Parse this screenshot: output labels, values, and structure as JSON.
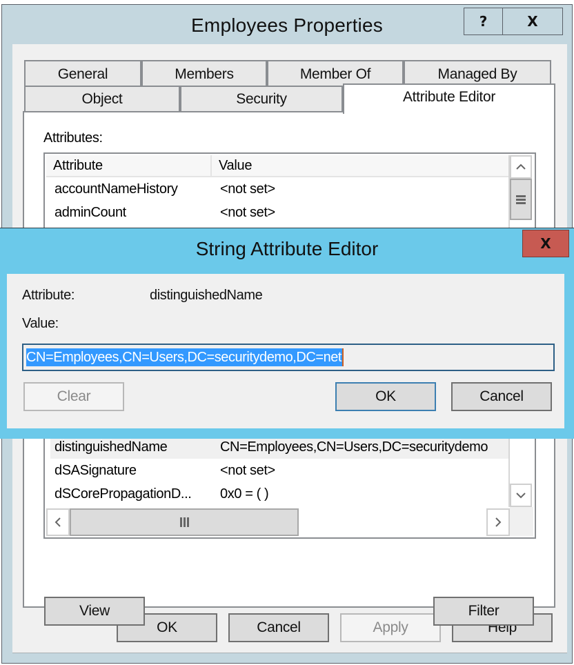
{
  "outer_window": {
    "title": "Employees Properties",
    "help_button": "?",
    "close_button": "X",
    "tabs_row1": [
      "General",
      "Members",
      "Member Of",
      "Managed By"
    ],
    "tabs_row2": [
      "Object",
      "Security",
      "Attribute Editor"
    ],
    "active_tab": "Attribute Editor",
    "attributes_label": "Attributes:",
    "list": {
      "columns": [
        "Attribute",
        "Value"
      ],
      "rows_visible_top": [
        {
          "attribute": "accountNameHistory",
          "value": "<not set>"
        },
        {
          "attribute": "adminCount",
          "value": "<not set>"
        }
      ],
      "rows_visible_bottom": [
        {
          "attribute": "distinguishedName",
          "value": "CN=Employees,CN=Users,DC=securitydemo",
          "selected": true
        },
        {
          "attribute": "dSASignature",
          "value": "<not set>"
        },
        {
          "attribute": "dSCorePropagationD...",
          "value": "0x0 = ( )"
        }
      ]
    },
    "view_button": "View",
    "filter_button": "Filter",
    "ok_button": "OK",
    "cancel_button": "Cancel",
    "apply_button": "Apply",
    "help_text_button": "Help"
  },
  "modal": {
    "title": "String Attribute Editor",
    "close_button": "X",
    "attribute_label": "Attribute:",
    "attribute_value": "distinguishedName",
    "value_label": "Value:",
    "value_text": "CN=Employees,CN=Users,DC=securitydemo,DC=net",
    "clear_button": "Clear",
    "ok_button": "OK",
    "cancel_button": "Cancel"
  },
  "icons": {
    "scroll_up": "^",
    "scroll_down": "v",
    "scroll_left": "<",
    "scroll_right": ">",
    "thumb_grip": "|||"
  },
  "colors": {
    "outer_frame": "#c4d7df",
    "modal_frame": "#6bc9ea",
    "modal_close": "#c75a52",
    "selection": "#3399ff"
  }
}
